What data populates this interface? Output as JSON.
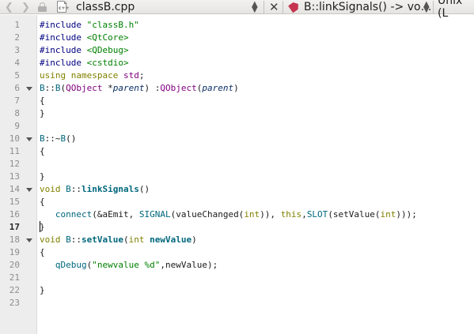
{
  "toolbar": {
    "back_icon": "chevron-left-icon",
    "forward_icon": "chevron-right-icon",
    "lock_icon": "lock-icon",
    "file_icon": "cpp-file-icon",
    "file_name": "classB.cpp",
    "close_glyph": "✕",
    "symbol_icon": "bookmark-icon",
    "symbol_label": "B::linkSignals() -> vo…",
    "line_ending": "Unix (L"
  },
  "editor": {
    "current_line": 17,
    "line_numbers": [
      "1",
      "2",
      "3",
      "4",
      "5",
      "6",
      "7",
      "8",
      "9",
      "10",
      "11",
      "12",
      "13",
      "14",
      "15",
      "16",
      "17",
      "18",
      "19",
      "20",
      "21",
      "22",
      "23"
    ],
    "lines": [
      "#include \"classB.h\"",
      "#include <QtCore>",
      "#include <QDebug>",
      "#include <cstdio>",
      "using namespace std;",
      "B::B(QObject *parent) :QObject(parent)",
      "{",
      "}",
      "",
      "B::~B()",
      "{",
      "",
      "}",
      "void B::linkSignals()",
      "{",
      "   connect(&aEmit, SIGNAL(valueChanged(int)), this,SLOT(setValue(int)));",
      "}",
      "void B::setValue(int newValue)",
      "{",
      "   qDebug(\"newvalue %d\",newValue);",
      "",
      "}",
      ""
    ]
  }
}
